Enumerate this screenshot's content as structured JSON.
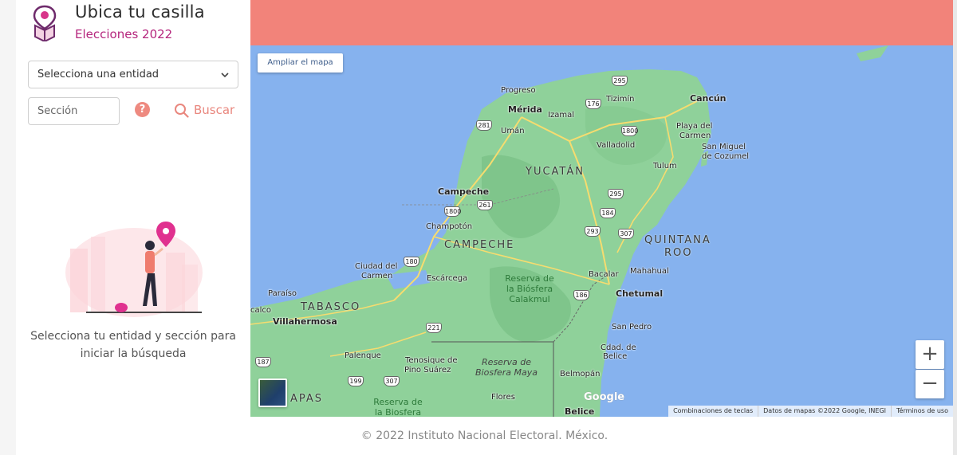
{
  "app": {
    "title": "Ubica tu casilla",
    "subtitle": "Elecciones 2022"
  },
  "sidebar": {
    "entity_select": {
      "selected": "Selecciona una entidad"
    },
    "section_input": {
      "placeholder": "Sección",
      "value": ""
    },
    "help_icon": "?",
    "search_label": "Buscar",
    "hint_line1": "Selecciona tu entidad y sección para",
    "hint_line2": "iniciar la búsqueda"
  },
  "map": {
    "expand_button": "Ampliar el mapa",
    "zoom_in": "+",
    "zoom_out": "−",
    "google_logo": "Google",
    "attribution": {
      "shortcuts": "Combinaciones de teclas",
      "data": "Datos de mapas ©2022 Google, INEGI",
      "terms": "Términos de uso"
    },
    "states": {
      "yucatan": "YUCATÁN",
      "campeche": "CAMPECHE",
      "quintana_roo_1": "QUINTANA",
      "quintana_roo_2": "ROO",
      "tabasco": "TABASCO",
      "chiapas": "APAS"
    },
    "cities": {
      "progreso": "Progreso",
      "merida": "Mérida",
      "izamal": "Izamal",
      "uman": "Umán",
      "tizimin": "Tizimín",
      "cancun": "Cancún",
      "playa1": "Playa del",
      "playa2": "Carmen",
      "sanmiguel1": "San Miguel",
      "sanmiguel2": "de Cozumel",
      "valladolid": "Valladolid",
      "tulum": "Tulum",
      "campeche": "Campeche",
      "champoton": "Champotón",
      "ciudad1": "Ciudad del",
      "ciudad2": "Carmen",
      "escarcega": "Escárcega",
      "bacalar": "Bacalar",
      "mahahual": "Mahahual",
      "chetumal": "Chetumal",
      "paraiso": "Paraíso",
      "villahermosa": "Villahermosa",
      "palenque": "Palenque",
      "tenosique1": "Tenosique de",
      "tenosique2": "Pino Suárez",
      "sanpedro": "San Pedro",
      "cdad1": "Cdad. de",
      "cdad2": "Belice",
      "belmopan": "Belmopán",
      "flores": "Flores",
      "belice": "Belice",
      "calco": "calco"
    },
    "reserves": {
      "calakmul_1": "Reserva de",
      "calakmul_2": "la Biósfera",
      "calakmul_3": "Calakmul",
      "maya_1": "Reserva de",
      "maya_2": "Biosfera Maya",
      "bottom_1": "Reserva de",
      "bottom_2": "la Biosfera"
    },
    "shields": [
      "295",
      "176",
      "281",
      "1800",
      "261",
      "1800",
      "295",
      "184",
      "293",
      "307",
      "180",
      "186",
      "221",
      "307",
      "199",
      "187"
    ]
  },
  "footer": "© 2022 Instituto Nacional Electoral. México.",
  "colors": {
    "accent": "#b5267d",
    "banner": "#f2837a",
    "search": "#e9877e",
    "water": "#86b2ee",
    "land": "#8fd19a"
  }
}
